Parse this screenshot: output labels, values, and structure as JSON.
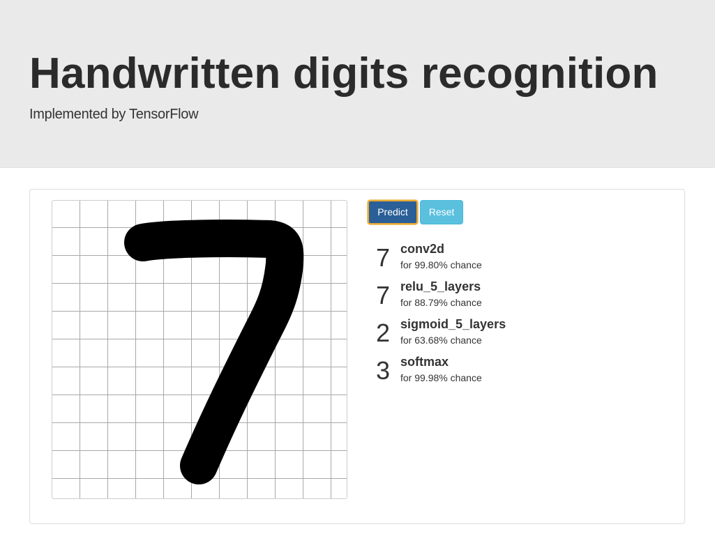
{
  "header": {
    "title": "Handwritten digits recognition",
    "subtitle": "Implemented by TensorFlow"
  },
  "canvas": {
    "grid_columns": 10,
    "grid_rows": 10,
    "drawn_digit": "7",
    "stroke_color": "#000000",
    "grid_color": "#a8a8a8"
  },
  "buttons": {
    "predict_label": "Predict",
    "reset_label": "Reset",
    "predict_color": "#2a5f98",
    "reset_color": "#5bc0de"
  },
  "results": [
    {
      "digit": "7",
      "model": "conv2d",
      "chance": "for 99.80% chance"
    },
    {
      "digit": "7",
      "model": "relu_5_layers",
      "chance": "for 88.79% chance"
    },
    {
      "digit": "2",
      "model": "sigmoid_5_layers",
      "chance": "for 63.68% chance"
    },
    {
      "digit": "3",
      "model": "softmax",
      "chance": "for 99.98% chance"
    }
  ]
}
